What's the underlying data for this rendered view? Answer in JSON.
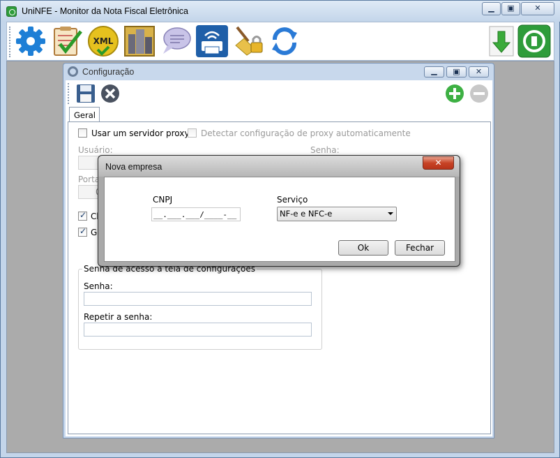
{
  "window": {
    "title": "UniNFE - Monitor da Nota Fiscal Eletrônica"
  },
  "toolbar": {
    "icons": [
      "gear-icon",
      "checklist-icon",
      "xml-icon",
      "buildings-icon",
      "chat-bubble-icon",
      "printer-wifi-icon",
      "broom-lock-icon",
      "refresh-icon",
      "download-icon",
      "power-icon"
    ]
  },
  "config": {
    "title": "Configuração",
    "tab": "Geral",
    "proxy_label": "Usar um servidor proxy",
    "auto_proxy_label": "Detectar configuração de proxy automaticamente",
    "user_label": "Usuário:",
    "password_label": "Senha:",
    "port_label": "Porta:",
    "port_value": "0",
    "check1_label": "Che",
    "check2_label": "Gra",
    "group_label": "Senha de acesso à tela de configurações",
    "senha_label": "Senha:",
    "repetir_label": "Repetir a senha:"
  },
  "dialog": {
    "title": "Nova empresa",
    "cnpj_label": "CNPJ",
    "cnpj_mask": "__.___.___/____-__",
    "service_label": "Serviço",
    "service_value": "NF-e e NFC-e",
    "ok_label": "Ok",
    "close_label": "Fechar"
  },
  "colors": {
    "accent_green": "#2e9c3a",
    "accent_blue": "#1f5fa8",
    "close_red": "#c74326"
  }
}
